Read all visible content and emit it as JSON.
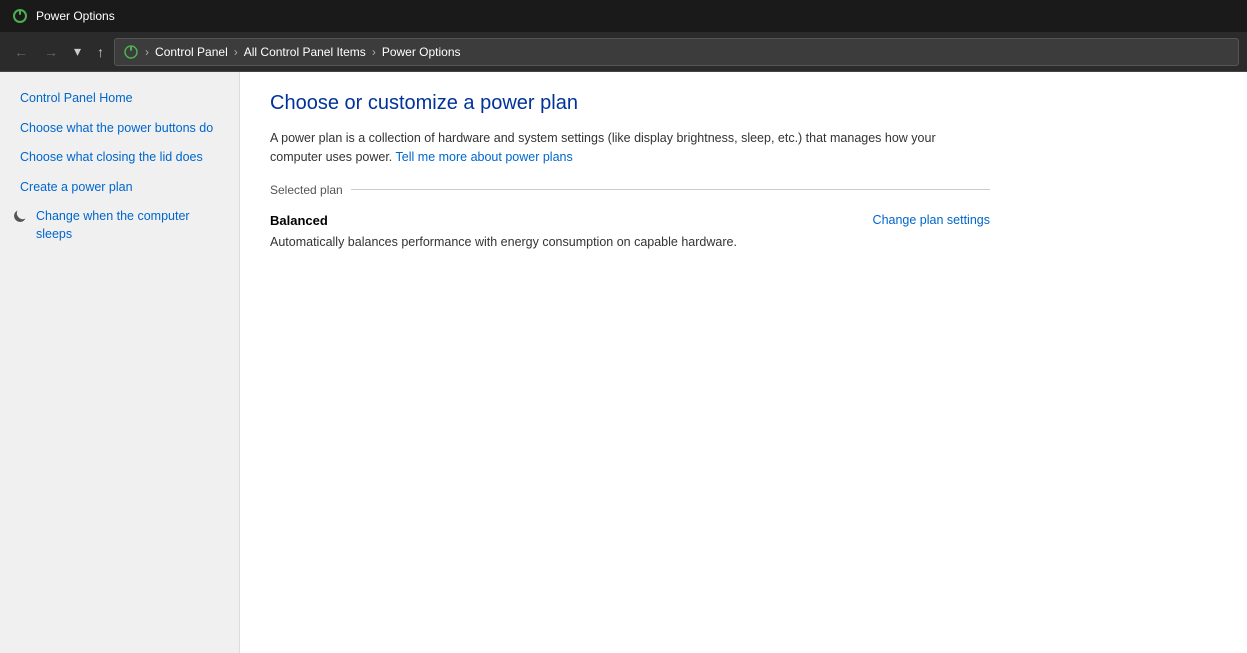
{
  "titleBar": {
    "title": "Power Options",
    "iconLabel": "power-options-icon"
  },
  "addressBar": {
    "back": "←",
    "forward": "→",
    "dropdown": "▾",
    "up": "↑",
    "path": [
      {
        "label": "Control Panel"
      },
      {
        "label": "All Control Panel Items"
      },
      {
        "label": "Power Options"
      }
    ]
  },
  "leftPanel": {
    "links": [
      {
        "id": "control-panel-home",
        "label": "Control Panel Home",
        "icon": null
      },
      {
        "id": "power-buttons",
        "label": "Choose what the power buttons do",
        "icon": null
      },
      {
        "id": "closing-lid",
        "label": "Choose what closing the lid does",
        "icon": null
      },
      {
        "id": "create-power-plan",
        "label": "Create a power plan",
        "icon": null
      },
      {
        "id": "change-sleep",
        "label": "Change when the computer sleeps",
        "icon": "moon"
      }
    ]
  },
  "content": {
    "title": "Choose or customize a power plan",
    "description": "A power plan is a collection of hardware and system settings (like display brightness, sleep, etc.) that manages how your computer uses power.",
    "descriptionLinkText": "Tell me more about power plans",
    "sectionLabel": "Selected plan",
    "plan": {
      "name": "Balanced",
      "description": "Automatically balances performance with energy consumption on capable hardware.",
      "changeLinkText": "Change plan settings"
    }
  }
}
